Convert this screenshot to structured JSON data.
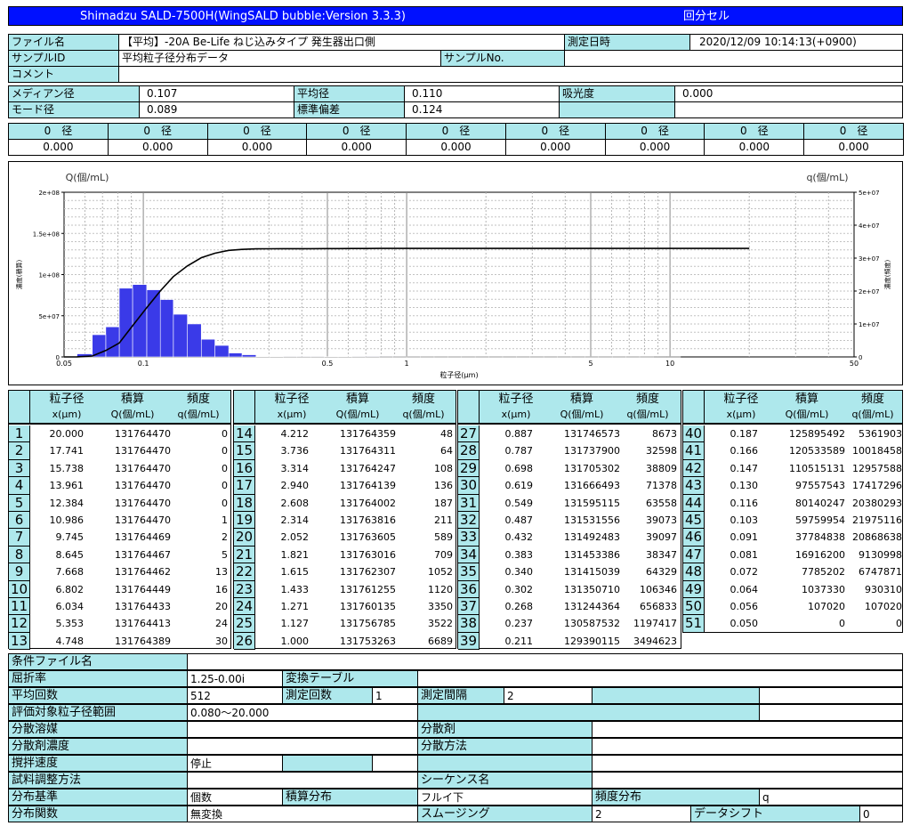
{
  "header": {
    "title": "Shimadzu SALD-7500H(WingSALD bubble:Version 3.3.3)",
    "mode": "回分セル"
  },
  "info": {
    "file_label": "ファイル名",
    "file_value": "【平均】-20A Be-Life ねじ込みタイプ 発生器出口側",
    "date_label": "測定日時",
    "date_value": "2020/12/09 10:14:13(+0900)",
    "sample_id_label": "サンプルID",
    "sample_id_value": "平均粒子径分布データ",
    "sample_no_label": "サンプルNo.",
    "comment_label": "コメント",
    "median_label": "メディアン径",
    "median_value": "0.107",
    "mean_label": "平均径",
    "mean_value": "0.110",
    "absorb_label": "吸光度",
    "absorb_value": "0.000",
    "mode_label": "モード径",
    "mode_value": "0.089",
    "std_label": "標準偏差",
    "std_value": "0.124"
  },
  "diameters": {
    "header": "0　径",
    "values": [
      "0.000",
      "0.000",
      "0.000",
      "0.000",
      "0.000",
      "0.000",
      "0.000",
      "0.000",
      "0.000"
    ]
  },
  "chart_data": {
    "type": "bar",
    "left_axis_label": "Q(個/mL)",
    "right_axis_label": "q(個/mL)",
    "left_side_label": "濃度(積算)",
    "right_side_label": "濃度(頻度)",
    "xlabel": "粒子径(μm)",
    "x_scale": "log",
    "xlim": [
      0.05,
      50
    ],
    "x_ticks": [
      "0.05",
      "0.1",
      "0.5",
      "1",
      "5",
      "10",
      "50"
    ],
    "left_ylim": [
      0,
      200000000
    ],
    "left_ticks": [
      "0",
      "5e+07",
      "1e+08",
      "1.5e+08",
      "2e+08"
    ],
    "right_ylim": [
      0,
      50000000
    ],
    "right_ticks": [
      "0",
      "1e+07",
      "2e+07",
      "3e+07",
      "4e+07",
      "5e+07"
    ],
    "grid": true,
    "bar_color": "#3a3ae8",
    "line_color": "#000000"
  },
  "table": {
    "h_size": "粒子径",
    "h_cum": "積算",
    "h_freq": "頻度",
    "u_size": "x(μm)",
    "u_cum": "Q(個/mL)",
    "u_freq": "q(個/mL)",
    "rows": [
      [
        "1",
        "20.000",
        "131764470",
        "0"
      ],
      [
        "2",
        "17.741",
        "131764470",
        "0"
      ],
      [
        "3",
        "15.738",
        "131764470",
        "0"
      ],
      [
        "4",
        "13.961",
        "131764470",
        "0"
      ],
      [
        "5",
        "12.384",
        "131764470",
        "0"
      ],
      [
        "6",
        "10.986",
        "131764470",
        "1"
      ],
      [
        "7",
        "9.745",
        "131764469",
        "2"
      ],
      [
        "8",
        "8.645",
        "131764467",
        "5"
      ],
      [
        "9",
        "7.668",
        "131764462",
        "13"
      ],
      [
        "10",
        "6.802",
        "131764449",
        "16"
      ],
      [
        "11",
        "6.034",
        "131764433",
        "20"
      ],
      [
        "12",
        "5.353",
        "131764413",
        "24"
      ],
      [
        "13",
        "4.748",
        "131764389",
        "30"
      ],
      [
        "14",
        "4.212",
        "131764359",
        "48"
      ],
      [
        "15",
        "3.736",
        "131764311",
        "64"
      ],
      [
        "16",
        "3.314",
        "131764247",
        "108"
      ],
      [
        "17",
        "2.940",
        "131764139",
        "136"
      ],
      [
        "18",
        "2.608",
        "131764002",
        "187"
      ],
      [
        "19",
        "2.314",
        "131763816",
        "211"
      ],
      [
        "20",
        "2.052",
        "131763605",
        "589"
      ],
      [
        "21",
        "1.821",
        "131763016",
        "709"
      ],
      [
        "22",
        "1.615",
        "131762307",
        "1052"
      ],
      [
        "23",
        "1.433",
        "131761255",
        "1120"
      ],
      [
        "24",
        "1.271",
        "131760135",
        "3350"
      ],
      [
        "25",
        "1.127",
        "131756785",
        "3522"
      ],
      [
        "26",
        "1.000",
        "131753263",
        "6689"
      ],
      [
        "27",
        "0.887",
        "131746573",
        "8673"
      ],
      [
        "28",
        "0.787",
        "131737900",
        "32598"
      ],
      [
        "29",
        "0.698",
        "131705302",
        "38809"
      ],
      [
        "30",
        "0.619",
        "131666493",
        "71378"
      ],
      [
        "31",
        "0.549",
        "131595115",
        "63558"
      ],
      [
        "32",
        "0.487",
        "131531556",
        "39073"
      ],
      [
        "33",
        "0.432",
        "131492483",
        "39097"
      ],
      [
        "34",
        "0.383",
        "131453386",
        "38347"
      ],
      [
        "35",
        "0.340",
        "131415039",
        "64329"
      ],
      [
        "36",
        "0.302",
        "131350710",
        "106346"
      ],
      [
        "37",
        "0.268",
        "131244364",
        "656833"
      ],
      [
        "38",
        "0.237",
        "130587532",
        "1197417"
      ],
      [
        "39",
        "0.211",
        "129390115",
        "3494623"
      ],
      [
        "40",
        "0.187",
        "125895492",
        "5361903"
      ],
      [
        "41",
        "0.166",
        "120533589",
        "10018458"
      ],
      [
        "42",
        "0.147",
        "110515131",
        "12957588"
      ],
      [
        "43",
        "0.130",
        "97557543",
        "17417296"
      ],
      [
        "44",
        "0.116",
        "80140247",
        "20380293"
      ],
      [
        "45",
        "0.103",
        "59759954",
        "21975116"
      ],
      [
        "46",
        "0.091",
        "37784838",
        "20868638"
      ],
      [
        "47",
        "0.081",
        "16916200",
        "9130998"
      ],
      [
        "48",
        "0.072",
        "7785202",
        "6747871"
      ],
      [
        "49",
        "0.064",
        "1037330",
        "930310"
      ],
      [
        "50",
        "0.056",
        "107020",
        "107020"
      ],
      [
        "51",
        "0.050",
        "0",
        "0"
      ]
    ]
  },
  "conditions": {
    "cond_file": "条件ファイル名",
    "refr": "屈折率",
    "refr_v": "1.25-0.00i",
    "conv": "変換テーブル",
    "avg_count": "平均回数",
    "avg_count_v": "512",
    "meas_count": "測定回数",
    "meas_count_v": "1",
    "meas_int": "測定間隔",
    "meas_int_v": "2",
    "range": "評価対象粒子径範囲",
    "range_v": "0.080～20.000",
    "solvent": "分散溶媒",
    "disp": "分散剤",
    "conc": "分散剤濃度",
    "method": "分散方法",
    "stir": "撹拌速度",
    "stir_v": "停止",
    "sample_adj": "試料調整方法",
    "seq": "シーケンス名",
    "basis": "分布基準",
    "basis_v": "個数",
    "cum_dist": "積算分布",
    "cum_dist_v": "フルイ下",
    "freq_dist": "頻度分布",
    "freq_dist_v": "q",
    "func": "分布関数",
    "func_v": "無変換",
    "smooth": "スムージング",
    "smooth_v": "2",
    "shift": "データシフト",
    "shift_v": "0"
  }
}
